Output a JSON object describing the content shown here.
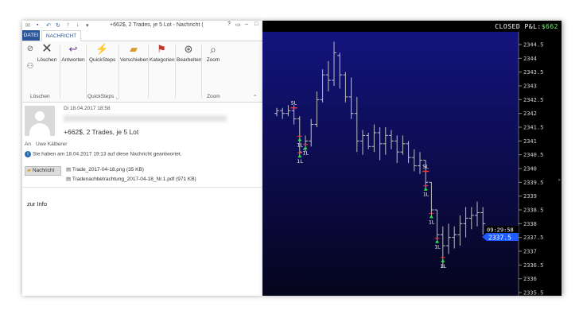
{
  "outlook": {
    "title": "+662$, 2 Trades, je 5 Lot - Nachricht (",
    "tabs": [
      "DATEI",
      "NACHRICHT"
    ],
    "ribbon": {
      "delete": "Löschen",
      "reply": "Antworten",
      "quicksteps": "QuickSteps",
      "move": "Verschieben",
      "categories": "Kategorien",
      "edit": "Bearbeiten",
      "zoom": "Zoom",
      "group_delete": "Löschen",
      "group_quicksteps": "QuickSteps",
      "group_zoom": "Zoom"
    },
    "message": {
      "date": "Di 18.04.2017 18:58",
      "sender": "                    ",
      "subject": "+662$, 2 Trades, je 5 Lot",
      "to_label": "An",
      "to": "Uwe Kälberer",
      "info": "Sie haben am 18.04.2017 19:13 auf diese Nachricht geantwortet.",
      "message_tab": "Nachricht",
      "attachments": [
        "Trade_2017-04-18.png (35 KB)",
        "Tradenachbetrachtung_2017-04-18_Nr.1.pdf (971 KB)"
      ],
      "body": "zur Info"
    }
  },
  "chart": {
    "closed_label": "CLOSED P&L:",
    "closed_value": "$662",
    "time": "09:29:58",
    "last_price": "2337.5",
    "price_labels": [
      "2344.5",
      "2344",
      "2343.5",
      "2343",
      "2342.5",
      "2342",
      "2341.5",
      "2341",
      "2340.5",
      "2340",
      "2339.5",
      "2339",
      "2338.5",
      "2338",
      "2337.5",
      "2337",
      "2336.5",
      "2336",
      "2335.5"
    ],
    "markers": [
      {
        "text": "SL",
        "kind": "sell",
        "price": 2342.2,
        "bar": 3
      },
      {
        "text": "1L",
        "kind": "buy",
        "price": 2341.0,
        "bar": 4
      },
      {
        "text": "1L",
        "kind": "buy",
        "price": 2340.7,
        "bar": 5
      },
      {
        "text": "1L",
        "kind": "buy",
        "price": 2340.4,
        "bar": 4
      },
      {
        "text": "SL",
        "kind": "sell",
        "price": 2339.9,
        "bar": 26
      },
      {
        "text": "1L",
        "kind": "buy",
        "price": 2339.2,
        "bar": 26
      },
      {
        "text": "1L",
        "kind": "buy",
        "price": 2338.2,
        "bar": 27
      },
      {
        "text": "1L",
        "kind": "buy",
        "price": 2337.3,
        "bar": 28
      },
      {
        "text": "1L",
        "kind": "buy",
        "price": 2336.6,
        "bar": 29
      }
    ],
    "bars": [
      [
        2342.2,
        2341.9,
        2342.0,
        2342.1
      ],
      [
        2342.2,
        2341.8,
        2342.1,
        2342.0
      ],
      [
        2342.3,
        2341.9,
        2342.0,
        2342.1
      ],
      [
        2342.3,
        2341.6,
        2342.1,
        2341.8
      ],
      [
        2341.9,
        2340.4,
        2341.8,
        2340.6
      ],
      [
        2341.2,
        2340.6,
        2340.7,
        2341.0
      ],
      [
        2341.8,
        2340.8,
        2341.0,
        2341.6
      ],
      [
        2342.8,
        2341.5,
        2341.6,
        2342.5
      ],
      [
        2343.6,
        2342.4,
        2342.5,
        2343.4
      ],
      [
        2343.9,
        2342.8,
        2343.4,
        2343.2
      ],
      [
        2344.6,
        2343.0,
        2343.2,
        2344.2
      ],
      [
        2344.2,
        2342.9,
        2344.1,
        2343.4
      ],
      [
        2343.5,
        2342.4,
        2343.4,
        2342.6
      ],
      [
        2343.3,
        2341.8,
        2342.6,
        2342.0
      ],
      [
        2342.6,
        2340.6,
        2342.0,
        2341.0
      ],
      [
        2341.4,
        2340.5,
        2341.0,
        2341.2
      ],
      [
        2341.3,
        2340.7,
        2341.2,
        2340.8
      ],
      [
        2341.6,
        2340.6,
        2340.8,
        2341.3
      ],
      [
        2341.5,
        2340.3,
        2341.3,
        2340.9
      ],
      [
        2341.5,
        2340.5,
        2340.9,
        2341.2
      ],
      [
        2341.4,
        2340.7,
        2341.2,
        2341.0
      ],
      [
        2341.2,
        2340.2,
        2341.0,
        2340.6
      ],
      [
        2341.2,
        2340.5,
        2340.6,
        2340.9
      ],
      [
        2341.0,
        2340.2,
        2340.9,
        2340.4
      ],
      [
        2340.7,
        2339.9,
        2340.4,
        2340.1
      ],
      [
        2340.6,
        2339.8,
        2340.1,
        2340.3
      ],
      [
        2340.3,
        2339.2,
        2340.3,
        2339.5
      ],
      [
        2339.5,
        2338.2,
        2339.5,
        2338.5
      ],
      [
        2338.5,
        2337.3,
        2338.5,
        2337.6
      ],
      [
        2337.9,
        2336.4,
        2337.6,
        2337.2
      ],
      [
        2338.0,
        2336.9,
        2337.2,
        2337.5
      ],
      [
        2337.9,
        2337.1,
        2337.5,
        2337.6
      ],
      [
        2338.3,
        2337.2,
        2337.6,
        2338.0
      ],
      [
        2338.6,
        2337.5,
        2338.0,
        2338.2
      ],
      [
        2338.6,
        2337.8,
        2338.2,
        2338.3
      ],
      [
        2338.8,
        2337.9,
        2338.3,
        2338.4
      ],
      [
        2338.6,
        2337.6,
        2338.4,
        2338.0
      ]
    ]
  }
}
